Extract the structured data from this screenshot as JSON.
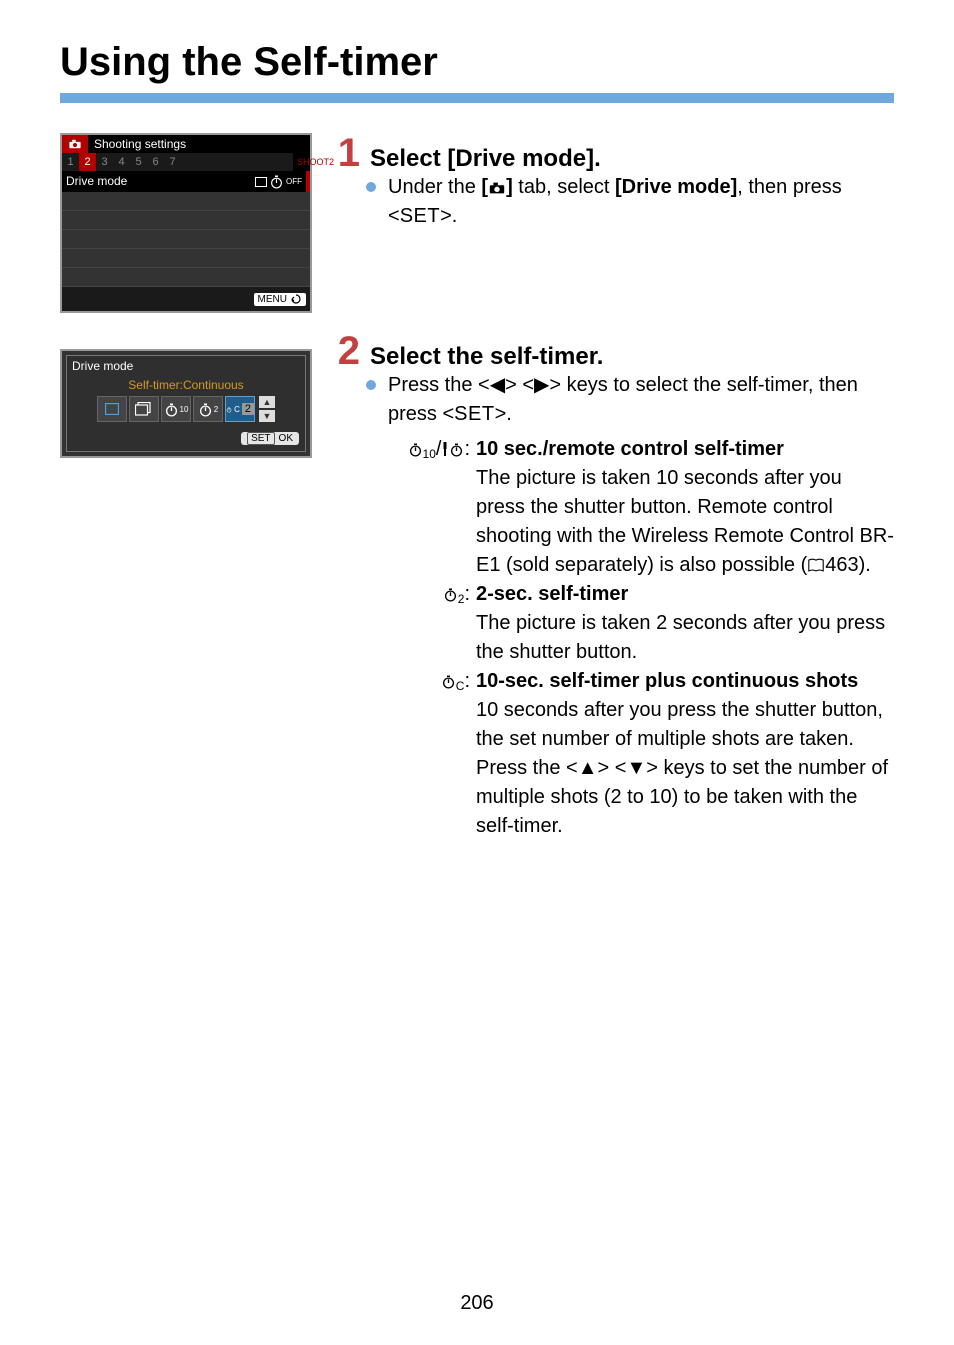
{
  "title": "Using the Self-timer",
  "page_number": "206",
  "screen1": {
    "header": "Shooting settings",
    "tabs": [
      "1",
      "2",
      "3",
      "4",
      "5",
      "6",
      "7"
    ],
    "active_tab": "2",
    "shoot_label": "SHOOT2",
    "row_label": "Drive mode",
    "menu_btn": "MENU"
  },
  "screen2": {
    "title": "Drive mode",
    "subtitle": "Self-timer:Continuous",
    "count_value": "2",
    "set_label": "SET",
    "ok_label": "OK"
  },
  "step1": {
    "num": "1",
    "title": "Select [Drive mode].",
    "line_a": "Under the ",
    "line_b": " tab, select ",
    "line_c": "[Drive mode]",
    "line_d": ", then press <",
    "set": "SET",
    "line_e": ">."
  },
  "step2": {
    "num": "2",
    "title": "Select the self-timer.",
    "press_a": "Press the <",
    "press_b": "> <",
    "press_c": "> keys to select the self-timer, then press <",
    "set": "SET",
    "press_d": ">.",
    "d1": {
      "title": "10 sec./remote control self-timer",
      "colon": ":",
      "body_a": "The picture is taken 10 seconds after you press the shutter button. Remote control shooting with the Wireless Remote Control BR-E1 (sold separately) is also possible (",
      "body_b": "463)."
    },
    "d2": {
      "title": "2-sec. self-timer",
      "colon": ":",
      "body": "The picture is taken 2 seconds after you press the shutter button."
    },
    "d3": {
      "title": "10-sec. self-timer plus continuous shots",
      "colon": ":",
      "body_a": "10 seconds after you press the shutter button, the set number of multiple shots are taken.",
      "body_b": "Press the <",
      "body_c": "> <",
      "body_d": "> keys to set the number of multiple shots (2 to 10) to be taken with the self-timer."
    }
  }
}
